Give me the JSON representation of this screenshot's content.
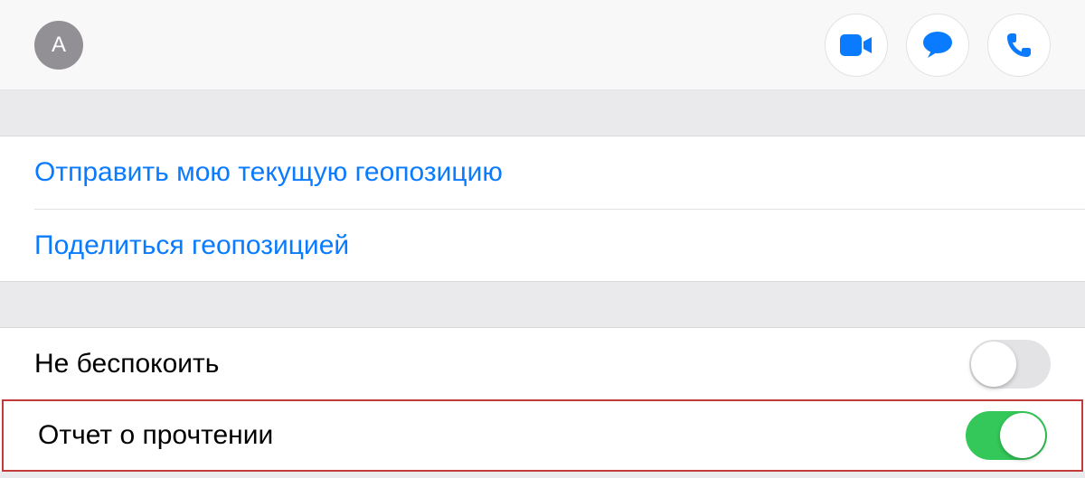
{
  "header": {
    "avatar_initial": "A"
  },
  "location_section": {
    "send_current_location": "Отправить мою текущую геопозицию",
    "share_location": "Поделиться геопозицией"
  },
  "settings_section": {
    "do_not_disturb": {
      "label": "Не беспокоить",
      "value": false
    },
    "read_receipts": {
      "label": "Отчет о прочтении",
      "value": true
    }
  }
}
